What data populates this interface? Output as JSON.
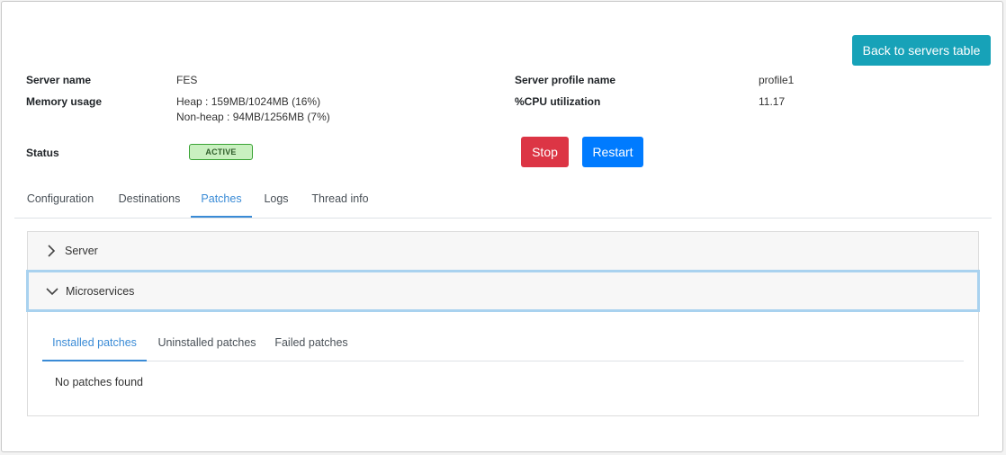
{
  "actions": {
    "back_label": "Back to servers table",
    "stop_label": "Stop",
    "restart_label": "Restart"
  },
  "info": {
    "server_name_label": "Server name",
    "server_name": "FES",
    "memory_label": "Memory usage",
    "heap": "Heap : 159MB/1024MB (16%)",
    "non_heap": "Non-heap : 94MB/1256MB (7%)",
    "status_label": "Status",
    "status": "ACTIVE",
    "profile_label": "Server profile name",
    "profile": "profile1",
    "cpu_label": "%CPU utilization",
    "cpu": "11.17"
  },
  "tabs": [
    {
      "label": "Configuration",
      "active": false
    },
    {
      "label": "Destinations",
      "active": false
    },
    {
      "label": "Patches",
      "active": true
    },
    {
      "label": "Logs",
      "active": false
    },
    {
      "label": "Thread info",
      "active": false
    }
  ],
  "accordion": {
    "server_label": "Server",
    "server_icon": "chevron-right-icon",
    "micro_label": "Microservices",
    "micro_icon": "chevron-down-icon"
  },
  "subtabs": [
    {
      "label": "Installed patches",
      "active": true
    },
    {
      "label": "Uninstalled patches",
      "active": false
    },
    {
      "label": "Failed patches",
      "active": false
    }
  ],
  "empty_message": "No patches found",
  "colors": {
    "info": "#17a2b8",
    "danger": "#dc3545",
    "primary": "#007bff",
    "active_tab": "#3a8bd6",
    "status_bg": "#c9f0c0",
    "status_border": "#3aa335",
    "focus_border": "#a9d2ef"
  }
}
